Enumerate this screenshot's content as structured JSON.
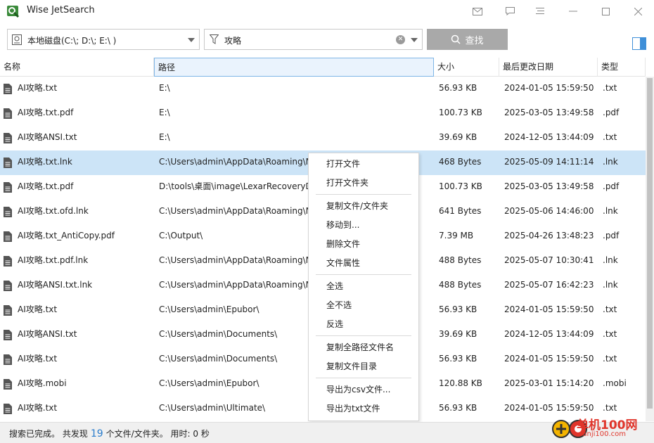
{
  "app": {
    "title": "Wise JetSearch"
  },
  "toolbar": {
    "drive_value": "本地磁盘(C:\\; D:\\; E:\\ )",
    "search_value": "攻略",
    "find_label": "查找"
  },
  "table": {
    "columns": [
      "名称",
      "路径",
      "大小",
      "最后更改日期",
      "类型"
    ],
    "rows": [
      {
        "name": "AI攻略.txt",
        "path": "E:\\",
        "size": "56.93 KB",
        "date": "2024-01-05 15:59:50",
        "type": ".txt"
      },
      {
        "name": "AI攻略.txt.pdf",
        "path": "E:\\",
        "size": "100.73 KB",
        "date": "2025-03-05 13:49:58",
        "type": ".pdf"
      },
      {
        "name": "AI攻略ANSI.txt",
        "path": "E:\\",
        "size": "39.69 KB",
        "date": "2024-12-05 13:44:09",
        "type": ".txt"
      },
      {
        "name": "AI攻略.txt.lnk",
        "path": "C:\\Users\\admin\\AppData\\Roaming\\M",
        "size": "468 Bytes",
        "date": "2025-05-09 14:11:14",
        "type": ".lnk"
      },
      {
        "name": "AI攻略.txt.pdf",
        "path": "D:\\tools\\桌面\\image\\LexarRecoveryD",
        "size": "100.73 KB",
        "date": "2025-03-05 13:49:58",
        "type": ".pdf"
      },
      {
        "name": "AI攻略.txt.ofd.lnk",
        "path": "C:\\Users\\admin\\AppData\\Roaming\\M",
        "size": "641 Bytes",
        "date": "2025-05-06 14:46:00",
        "type": ".lnk"
      },
      {
        "name": "AI攻略.txt_AntiCopy.pdf",
        "path": "C:\\Output\\",
        "size": "7.39 MB",
        "date": "2025-04-26 13:48:23",
        "type": ".pdf"
      },
      {
        "name": "AI攻略.txt.pdf.lnk",
        "path": "C:\\Users\\admin\\AppData\\Roaming\\M",
        "size": "488 Bytes",
        "date": "2025-05-07 10:30:41",
        "type": ".lnk"
      },
      {
        "name": "AI攻略ANSI.txt.lnk",
        "path": "C:\\Users\\admin\\AppData\\Roaming\\M",
        "size": "488 Bytes",
        "date": "2025-05-07 16:42:23",
        "type": ".lnk"
      },
      {
        "name": "AI攻略.txt",
        "path": "C:\\Users\\admin\\Epubor\\",
        "size": "56.93 KB",
        "date": "2024-01-05 15:59:50",
        "type": ".txt"
      },
      {
        "name": "AI攻略ANSI.txt",
        "path": "C:\\Users\\admin\\Documents\\",
        "size": "39.69 KB",
        "date": "2024-12-05 13:44:09",
        "type": ".txt"
      },
      {
        "name": "AI攻略.txt",
        "path": "C:\\Users\\admin\\Documents\\",
        "size": "56.93 KB",
        "date": "2024-01-05 15:59:50",
        "type": ".txt"
      },
      {
        "name": "AI攻略.mobi",
        "path": "C:\\Users\\admin\\Epubor\\",
        "size": "120.88 KB",
        "date": "2025-03-01 15:14:20",
        "type": ".mobi"
      },
      {
        "name": "AI攻略.txt",
        "path": "C:\\Users\\admin\\Ultimate\\",
        "size": "56.93 KB",
        "date": "2024-01-05 15:59:50",
        "type": ".txt"
      }
    ]
  },
  "context_menu": {
    "groups": [
      [
        "打开文件",
        "打开文件夹"
      ],
      [
        "复制文件/文件夹",
        "移动到...",
        "删除文件",
        "文件属性"
      ],
      [
        "全选",
        "全不选",
        "反选"
      ],
      [
        "复制全路径文件名",
        "复制文件目录"
      ],
      [
        "导出为csv文件...",
        "导出为txt文件"
      ]
    ]
  },
  "status": {
    "prefix": "搜索已完成。 共发现",
    "count": "19",
    "suffix": "个文件/文件夹。 用时:  0 秒"
  },
  "watermark": {
    "text": "单机100网",
    "sub": "danji100.com"
  },
  "colors": {
    "accent": "#2a7ccc",
    "selected_row": "#cce4f7",
    "find_button": "#a9a9a9"
  }
}
